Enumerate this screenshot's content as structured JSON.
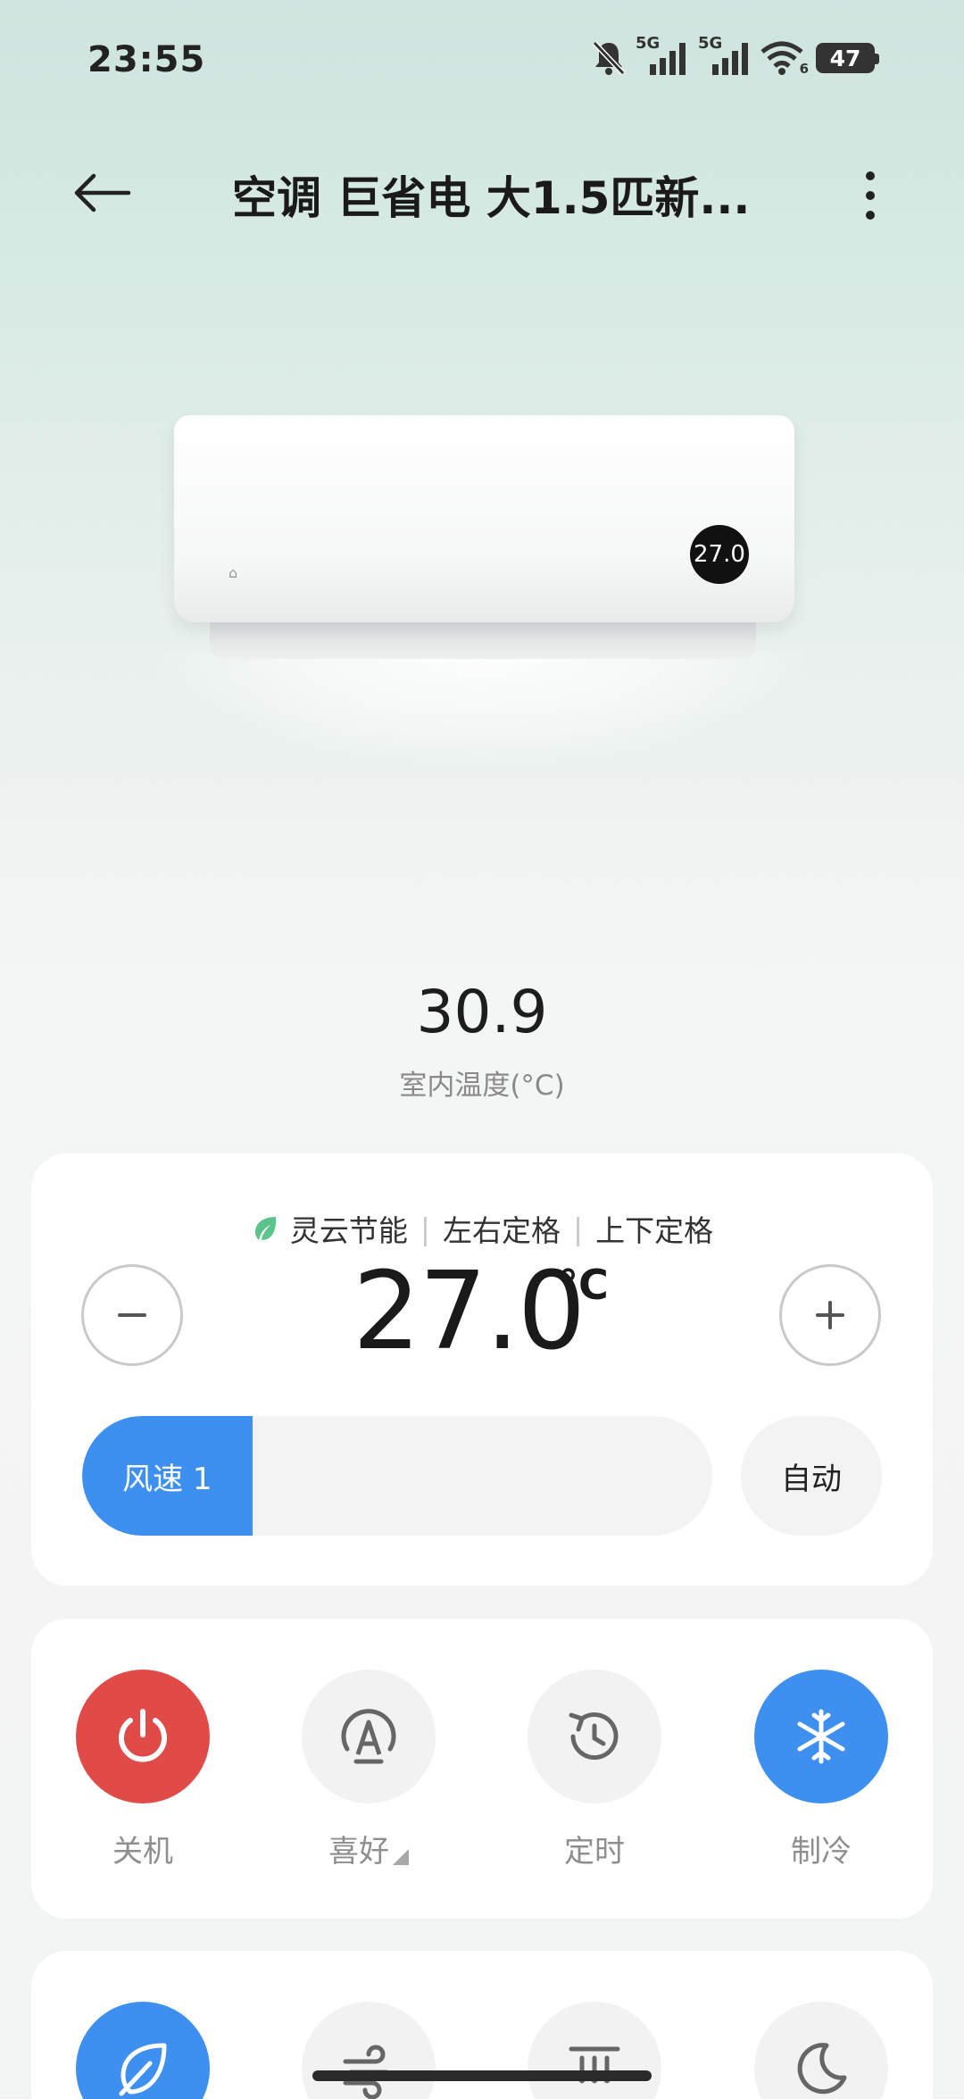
{
  "status_bar": {
    "time": "23:55",
    "network_1": "5G",
    "network_2": "5G",
    "wifi_badge": "6",
    "battery": "47"
  },
  "header": {
    "title": "空调 巨省电 大1.5匹新..."
  },
  "device": {
    "display_value": "27.0"
  },
  "indoor": {
    "value": "30.9",
    "label": "室内温度(°C)"
  },
  "control": {
    "tags": [
      "灵云节能",
      "左右定格",
      "上下定格"
    ],
    "set_temperature": "27.0",
    "unit": "°C",
    "fan_speed_label": "风速 1",
    "fan_speed_fraction": 0.27,
    "auto_label": "自动"
  },
  "modes": [
    {
      "label": "关机",
      "icon": "power-icon",
      "state": "red"
    },
    {
      "label": "喜好",
      "icon": "auto-a-icon",
      "state": "default"
    },
    {
      "label": "定时",
      "icon": "timer-icon",
      "state": "default"
    },
    {
      "label": "制冷",
      "icon": "snowflake-icon",
      "state": "blue"
    }
  ],
  "more_functions": [
    {
      "icon": "leaf-icon",
      "state": "blue"
    },
    {
      "icon": "wind-icon",
      "state": "default"
    },
    {
      "icon": "downflow-icon",
      "state": "default"
    },
    {
      "icon": "moon-icon",
      "state": "default"
    }
  ],
  "colors": {
    "accent_blue": "#3d8ff0",
    "power_red": "#e04b48",
    "eco_green": "#5ac48a"
  }
}
